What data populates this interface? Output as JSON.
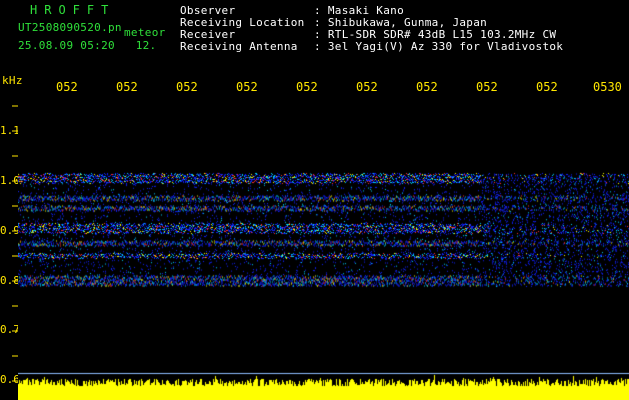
{
  "header": {
    "brand": "HROFFT",
    "filename": "UT2508090520.pn",
    "filename_suffix": "meteor",
    "timestamp": "25.08.09 05:20",
    "timestamp_extra": "12.",
    "rows": [
      {
        "label": "Observer",
        "value": ": Masaki Kano"
      },
      {
        "label": "Receiving Location",
        "value": ": Shibukawa, Gunma, Japan"
      },
      {
        "label": "Receiver",
        "value": ": RTL-SDR SDR# 43dB L15 103.2MHz CW"
      },
      {
        "label": "Receiving Antenna",
        "value": ": 3el Yagi(V) Az 330 for Vladivostok"
      }
    ]
  },
  "axis": {
    "unit": "kHz",
    "y_ticks": [
      "1.1",
      "1.0",
      "0.9",
      "0.8",
      "0.7",
      "0.6"
    ],
    "x_ticks": [
      "052",
      "052",
      "052",
      "052",
      "052",
      "052",
      "052",
      "052",
      "052",
      "0530"
    ]
  },
  "spectrogram": {
    "colors": {
      "background": "#000000",
      "low": "#1020ff",
      "mid": "#00d0ff",
      "high": "#ff3030",
      "peak": "#ffff00",
      "bottom_bar": "#ffff00"
    },
    "bands_khz": [
      1.01,
      1.0,
      0.965,
      0.945,
      0.91,
      0.9,
      0.875,
      0.85,
      0.805,
      0.795
    ],
    "bottom_bar_freq_khz": 0.6
  }
}
